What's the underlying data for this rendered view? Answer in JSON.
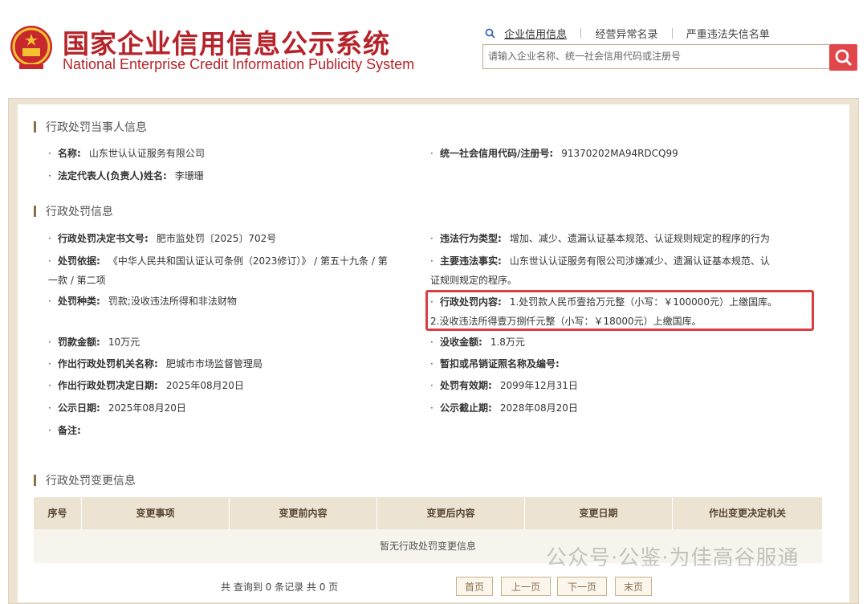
{
  "header": {
    "title_cn": "国家企业信用信息公示系统",
    "title_en": "National Enterprise Credit Information Publicity System",
    "links": [
      "企业信用信息",
      "经营异常名录",
      "严重违法失信名单"
    ],
    "search_placeholder": "请输入企业名称、统一社会信用代码或注册号"
  },
  "party_section": {
    "title": "行政处罚当事人信息",
    "name_label": "名称:",
    "name_value": "山东世认认证服务有限公司",
    "credit_code_label": "统一社会信用代码/注册号:",
    "credit_code_value": "91370202MA94RDCQ99",
    "legal_rep_label": "法定代表人(负责人)姓名:",
    "legal_rep_value": "李珊珊"
  },
  "penalty_section": {
    "title": "行政处罚信息",
    "doc_no_label": "行政处罚决定书文号:",
    "doc_no_value": "肥市监处罚〔2025〕702号",
    "violation_type_label": "违法行为类型:",
    "violation_type_value": "增加、减少、遗漏认证基本规范、认证规则规定的程序的行为",
    "basis_label": "处罚依据:",
    "basis_value_line1": "《中华人民共和国认证认可条例（2023修订）》 / 第五十九条 / 第",
    "basis_value_line2": "一款 / 第二项",
    "facts_label": "主要违法事实:",
    "facts_value_line1": "山东世认认证服务有限公司涉嫌减少、遗漏认证基本规范、认",
    "facts_value_line2": "证规则规定的程序。",
    "kind_label": "处罚种类:",
    "kind_value": "罚款;没收违法所得和非法财物",
    "content_label": "行政处罚内容:",
    "content_value_line1": "1.处罚款人民币壹拾万元整（小写：￥100000元）上缴国库。",
    "content_value_line2": "2.没收违法所得壹万捌仟元整（小写：￥18000元）上缴国库。",
    "fine_label": "罚款金额:",
    "fine_value": "10万元",
    "confiscation_label": "没收金额:",
    "confiscation_value": "1.8万元",
    "authority_label": "作出行政处罚机关名称:",
    "authority_value": "肥城市市场监督管理局",
    "license_label": "暂扣或吊销证照名称及编号:",
    "license_value": "",
    "decision_date_label": "作出行政处罚决定日期:",
    "decision_date_value": "2025年08月20日",
    "validity_label": "处罚有效期:",
    "validity_value": "2099年12月31日",
    "publish_date_label": "公示日期:",
    "publish_date_value": "2025年08月20日",
    "publish_end_label": "公示截止期:",
    "publish_end_value": "2028年08月20日",
    "remark_label": "备注:",
    "remark_value": ""
  },
  "change_section": {
    "title": "行政处罚变更信息",
    "columns": [
      "序号",
      "变更事项",
      "变更前内容",
      "变更后内容",
      "变更日期",
      "作出变更决定机关"
    ],
    "empty_text": "暂无行政处罚变更信息",
    "pager_info": "共 查询到 0 条记录 共 0 页",
    "pager_buttons": [
      "首页",
      "上一页",
      "下一页",
      "末页"
    ]
  },
  "watermark": "公众号·公鉴·为佳高谷服通"
}
